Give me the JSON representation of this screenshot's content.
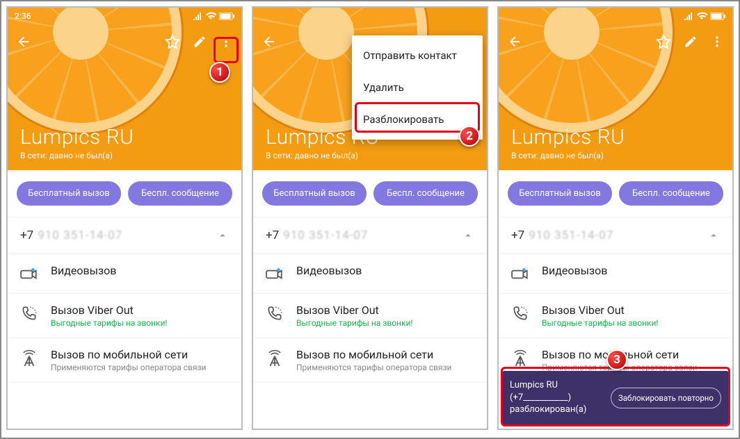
{
  "status": {
    "time": "2:36"
  },
  "contact": {
    "name": "Lumpics RU",
    "status": "В сети: давно не был(а)",
    "phone_cc": "+7",
    "phone_rest": "910 351-14-07"
  },
  "actions": {
    "free_call": "Бесплатный вызов",
    "free_msg": "Беспл. сообщение"
  },
  "items": {
    "video": {
      "title": "Видеовызов"
    },
    "vout": {
      "title": "Вызов Viber Out",
      "sub": "Выгодные тарифы на звонки!"
    },
    "cellular": {
      "title": "Вызов по мобильной сети",
      "sub": "Применяются тарифы оператора связи"
    }
  },
  "menu": {
    "send_contact": "Отправить контакт",
    "delete": "Удалить",
    "unblock": "Разблокировать"
  },
  "snackbar": {
    "text": "Lumpics RU (+7___________) разблокирован(а)",
    "action": "Заблокировать повторно"
  },
  "badges": {
    "one": "1",
    "two": "2",
    "three": "3"
  },
  "icons": {
    "back": "back-arrow",
    "star": "star-icon",
    "pencil": "edit-icon",
    "more": "more-vert-icon",
    "chevron": "chevron-up-icon",
    "camera": "camera-icon",
    "phone": "phone-icon",
    "antenna": "antenna-icon"
  }
}
